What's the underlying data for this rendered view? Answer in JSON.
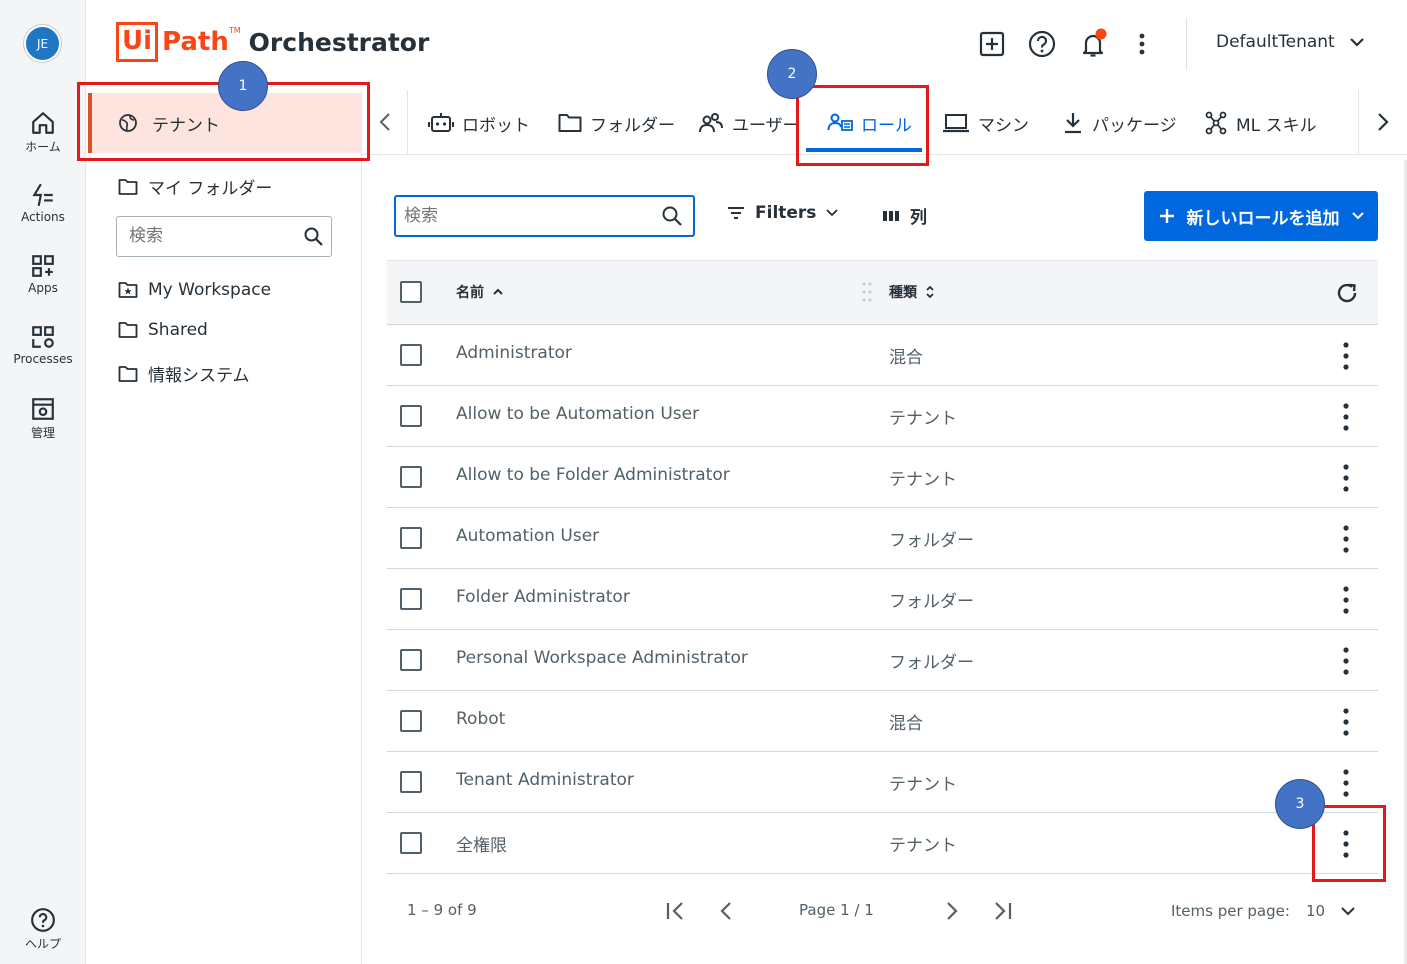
{
  "user": {
    "initials": "JE"
  },
  "rail": {
    "home": "ホーム",
    "actions": "Actions",
    "apps": "Apps",
    "processes": "Processes",
    "admin": "管理",
    "help": "ヘルプ"
  },
  "header": {
    "logo_ui": "Ui",
    "logo_path": "Path",
    "logo_tm": "TM",
    "logo_product": "Orchestrator",
    "tenant": "DefaultTenant",
    "notification_color": "#fa4616"
  },
  "sidebar": {
    "tenant_label": "テナント",
    "my_folder": "マイ フォルダー",
    "search_placeholder": "検索",
    "folders": [
      "My Workspace",
      "Shared",
      "情報システム"
    ]
  },
  "tabs": [
    {
      "label": "ロボット",
      "icon": "robot-icon"
    },
    {
      "label": "フォルダー",
      "icon": "folder-icon"
    },
    {
      "label": "ユーザー",
      "icon": "users-icon"
    },
    {
      "label": "ロール",
      "icon": "roles-icon",
      "active": true
    },
    {
      "label": "マシン",
      "icon": "laptop-icon"
    },
    {
      "label": "パッケージ",
      "icon": "download-icon"
    },
    {
      "label": "ML スキル",
      "icon": "ml-skill-icon"
    }
  ],
  "toolbar": {
    "search_placeholder": "検索",
    "filters_label": "Filters",
    "columns_label": "列",
    "add_label": "新しいロールを追加"
  },
  "table": {
    "col_name": "名前",
    "col_type": "種類",
    "rows": [
      {
        "name": "Administrator",
        "type": "混合"
      },
      {
        "name": "Allow to be Automation User",
        "type": "テナント"
      },
      {
        "name": "Allow to be Folder Administrator",
        "type": "テナント"
      },
      {
        "name": "Automation User",
        "type": "フォルダー"
      },
      {
        "name": "Folder Administrator",
        "type": "フォルダー"
      },
      {
        "name": "Personal Workspace Administrator",
        "type": "フォルダー"
      },
      {
        "name": "Robot",
        "type": "混合"
      },
      {
        "name": "Tenant Administrator",
        "type": "テナント"
      },
      {
        "name": "全権限",
        "type": "テナント"
      }
    ]
  },
  "pagination": {
    "range": "1 – 9 of 9",
    "page": "Page 1 / 1",
    "items_per_page_label": "Items per page:",
    "items_per_page": "10"
  },
  "annotations": {
    "step1": "1",
    "step2": "2",
    "step3": "3",
    "box_color": "#e3191c",
    "marker_color": "#4472c4"
  }
}
